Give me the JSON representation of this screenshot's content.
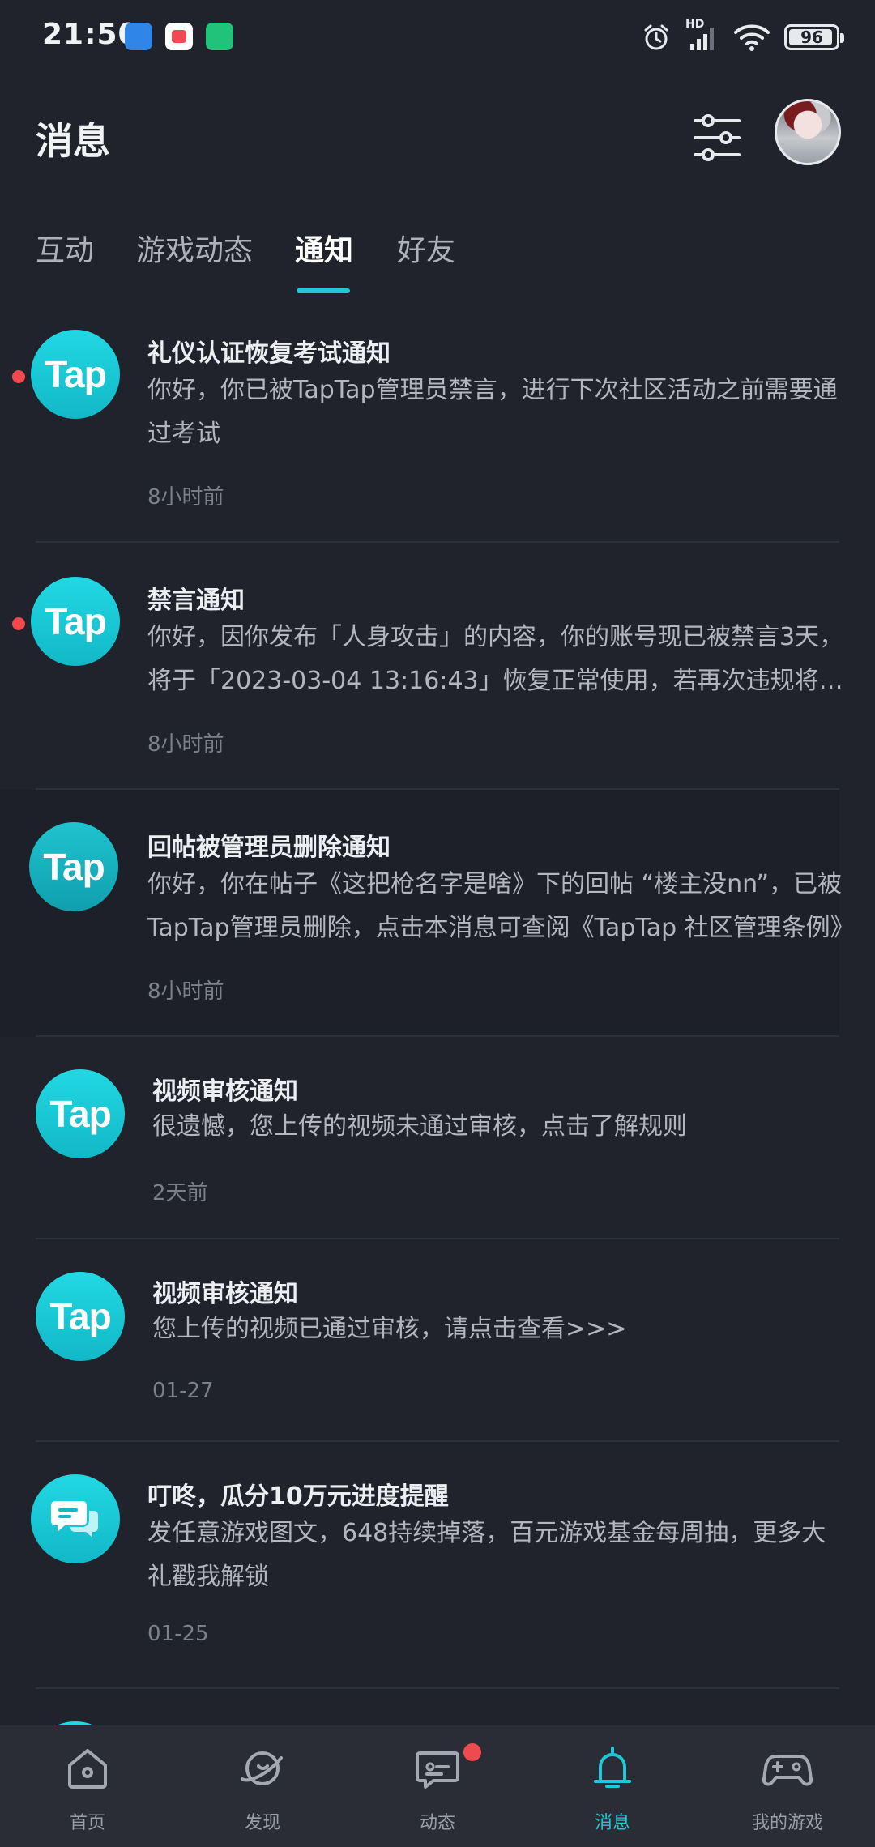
{
  "status_bar": {
    "time": "21:50",
    "battery": "96",
    "signal_label": "HD",
    "icons": [
      "alarm-icon",
      "signal-icon",
      "wifi-icon",
      "battery-icon"
    ]
  },
  "header": {
    "title": "消息",
    "filter_icon": "sliders-icon",
    "avatar": "user-avatar"
  },
  "tabs": [
    {
      "label": "互动",
      "active": false
    },
    {
      "label": "游戏动态",
      "active": false
    },
    {
      "label": "通知",
      "active": true
    },
    {
      "label": "好友",
      "active": false
    }
  ],
  "notifications": [
    {
      "icon_text": "Tap",
      "title": "礼仪认证恢复考试通知",
      "body": "你好，你已被TapTap管理员禁言，进行下次社区活动之前需要通过考试",
      "time": "8小时前",
      "unread": true
    },
    {
      "icon_text": "Tap",
      "title": "禁言通知",
      "body": "你好，因你发布「人身攻击」的内容，你的账号现已被禁言3天，将于「2023-03-04 13:16:43」恢复正常使用，若再次违规将会受到更严厉的处罚",
      "time": "8小时前",
      "unread": true
    },
    {
      "icon_text": "Tap",
      "title": "回帖被管理员删除通知",
      "body": "你好，你在帖子《这把枪名字是啥》下的回帖 “楼主没nn”，已被TapTap管理员删除，点击本消息可查阅《TapTap 社区管理条例》",
      "time": "8小时前",
      "unread": false
    },
    {
      "icon_text": "Tap",
      "title": "视频审核通知",
      "body": "很遗憾，您上传的视频未通过审核，点击了解规则",
      "time": "2天前",
      "unread": false
    },
    {
      "icon_text": "Tap",
      "title": "视频审核通知",
      "body": "您上传的视频已通过审核，请点击查看>>>",
      "time": "01-27",
      "unread": false
    },
    {
      "icon_text": "",
      "title": "叮咚，瓜分10万元进度提醒",
      "body": "发任意游戏图文，648持续掉落，百元游戏基金每周抽，更多大礼戳我解锁",
      "time": "01-25",
      "unread": false
    }
  ],
  "bottom_nav": [
    {
      "label": "首页",
      "icon": "home-icon",
      "active": false
    },
    {
      "label": "发现",
      "icon": "planet-icon",
      "active": false
    },
    {
      "label": "动态",
      "icon": "chat-icon",
      "active": false,
      "badge": true
    },
    {
      "label": "消息",
      "icon": "bell-icon",
      "active": true
    },
    {
      "label": "我的游戏",
      "icon": "gamepad-icon",
      "active": false
    }
  ],
  "colors": {
    "background": "#20232b",
    "accent": "#1fc8d6",
    "unread": "#f04a4f",
    "nav_bg": "#2a2d36"
  }
}
